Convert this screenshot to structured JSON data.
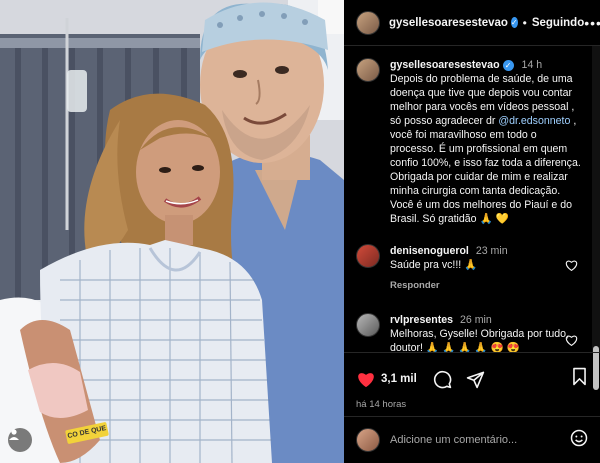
{
  "post": {
    "username": "gysellesoaresestevao",
    "follow_label": "Seguindo",
    "more_label": "•••"
  },
  "caption": {
    "username": "gysellesoaresestevao",
    "time": "14 h",
    "text_before_mention": "Depois do problema de saúde, de uma doença que tive  que depois vou contar melhor para vocês em vídeos pessoal , só posso agradecer dr ",
    "mention": "@dr.edsonneto",
    "text_after_mention": " , você foi maravilhoso em todo o processo. É um profissional em quem confio 100%, e isso faz toda a diferença. Obrigada por cuidar de mim e realizar minha cirurgia com tanta dedicação. Você é um dos melhores do Piauí e do Brasil. Só gratidão 🙏 💛"
  },
  "comments": [
    {
      "username": "denisenoguerol",
      "time": "23 min",
      "text": "Saúde pra vc!!! 🙏",
      "reply_label": "Responder"
    },
    {
      "username": "rvlpresentes",
      "time": "26 min",
      "text": "Melhoras, Gyselle! Obrigada por tudo, doutor! 🙏 🙏 🙏 🙏 😍 😍"
    }
  ],
  "actions": {
    "likes": "3,1 mil",
    "age": "há 14 horas",
    "icons": [
      "heart-filled-icon",
      "comment-icon",
      "share-icon",
      "bookmark-icon"
    ]
  },
  "composer": {
    "placeholder": "Adicione um comentário..."
  },
  "photo": {
    "wristband_text": "CO DE QUE"
  },
  "colors": {
    "background": "#000000",
    "verified": "#3897f0",
    "like_red": "#ff3040",
    "muted_text": "#a8a8a8",
    "mention": "#9fd0ff"
  }
}
